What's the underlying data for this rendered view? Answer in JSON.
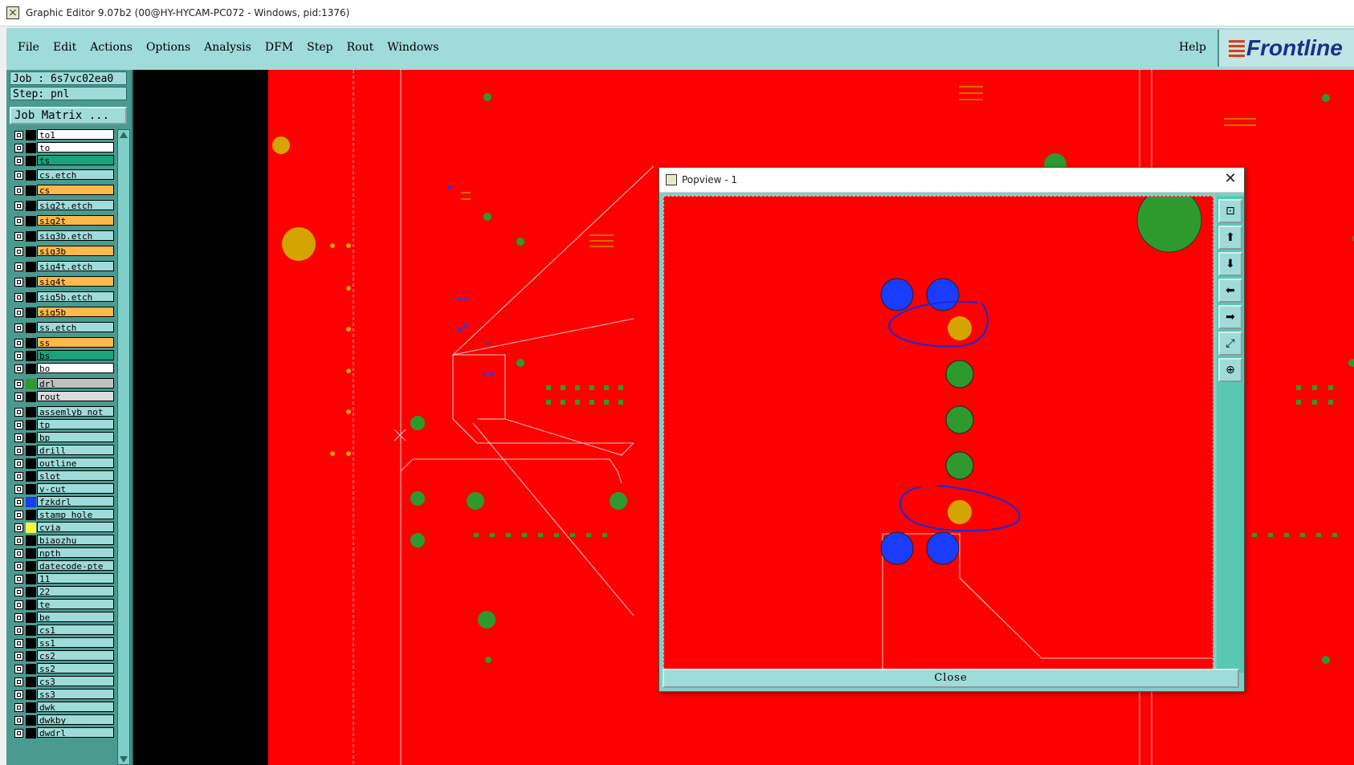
{
  "window": {
    "title": "Graphic Editor 9.07b2 (00@HY-HYCAM-PC072 - Windows, pid:1376)"
  },
  "menubar": {
    "items": [
      "File",
      "Edit",
      "Actions",
      "Options",
      "Analysis",
      "DFM",
      "Step",
      "Rout",
      "Windows"
    ],
    "help": "Help",
    "logo": "Frontline"
  },
  "job": {
    "label": "Job : 6s7vc02ea0",
    "step": "Step: pnl",
    "matrix_button": "Job Matrix ..."
  },
  "layers": [
    {
      "name": "to1",
      "color": "#ffffff",
      "swatch": "#000000"
    },
    {
      "name": "to",
      "color": "#ffffff",
      "swatch": "#000000"
    },
    {
      "name": "ts",
      "color": "#1aa37a",
      "swatch": "#000000"
    },
    {
      "name": "cs.etch",
      "color": "#9fdbd9",
      "swatch": "#000000"
    },
    {
      "name": "cs",
      "color": "#ffb84a",
      "swatch": "#000000"
    },
    {
      "name": "sig2t.etch",
      "color": "#9fdbd9",
      "swatch": "#000000"
    },
    {
      "name": "sig2t",
      "color": "#ffb84a",
      "swatch": "#000000"
    },
    {
      "name": "sig3b.etch",
      "color": "#9fdbd9",
      "swatch": "#000000"
    },
    {
      "name": "sig3b",
      "color": "#ffb84a",
      "swatch": "#000000"
    },
    {
      "name": "sig4t.etch",
      "color": "#9fdbd9",
      "swatch": "#000000"
    },
    {
      "name": "sig4t",
      "color": "#ffb84a",
      "swatch": "#000000"
    },
    {
      "name": "sig5b.etch",
      "color": "#9fdbd9",
      "swatch": "#000000"
    },
    {
      "name": "sig5b",
      "color": "#ffb84a",
      "swatch": "#000000"
    },
    {
      "name": "ss.etch",
      "color": "#9fdbd9",
      "swatch": "#000000"
    },
    {
      "name": "ss",
      "color": "#ffb84a",
      "swatch": "#000000"
    },
    {
      "name": "bs",
      "color": "#1aa37a",
      "swatch": "#000000"
    },
    {
      "name": "bo",
      "color": "#ffffff",
      "swatch": "#000000"
    },
    {
      "name": "drl",
      "color": "#c0c0c0",
      "swatch": "#2e9a2e"
    },
    {
      "name": "rout",
      "color": "#dcdcdc",
      "swatch": "#000000"
    },
    {
      "name": "assemlyb_not",
      "color": "#9fdbd9",
      "swatch": "#000000"
    },
    {
      "name": "tp",
      "color": "#9fdbd9",
      "swatch": "#000000"
    },
    {
      "name": "bp",
      "color": "#9fdbd9",
      "swatch": "#000000"
    },
    {
      "name": "drill",
      "color": "#9fdbd9",
      "swatch": "#000000"
    },
    {
      "name": "outline",
      "color": "#9fdbd9",
      "swatch": "#000000"
    },
    {
      "name": "slot",
      "color": "#9fdbd9",
      "swatch": "#000000"
    },
    {
      "name": "v-cut",
      "color": "#9fdbd9",
      "swatch": "#000000"
    },
    {
      "name": "fzkdrl",
      "color": "#9fdbd9",
      "swatch": "#1a3cff"
    },
    {
      "name": "stamp_hole",
      "color": "#9fdbd9",
      "swatch": "#000000"
    },
    {
      "name": "cvia",
      "color": "#9fdbd9",
      "swatch": "#f5f542"
    },
    {
      "name": "biaozhu",
      "color": "#9fdbd9",
      "swatch": "#000000"
    },
    {
      "name": "npth",
      "color": "#9fdbd9",
      "swatch": "#000000"
    },
    {
      "name": "datecode-pte",
      "color": "#9fdbd9",
      "swatch": "#000000"
    },
    {
      "name": "11",
      "color": "#9fdbd9",
      "swatch": "#000000"
    },
    {
      "name": "22",
      "color": "#9fdbd9",
      "swatch": "#000000"
    },
    {
      "name": "te",
      "color": "#9fdbd9",
      "swatch": "#000000"
    },
    {
      "name": "be",
      "color": "#9fdbd9",
      "swatch": "#000000"
    },
    {
      "name": "cs1",
      "color": "#9fdbd9",
      "swatch": "#000000"
    },
    {
      "name": "ss1",
      "color": "#9fdbd9",
      "swatch": "#000000"
    },
    {
      "name": "cs2",
      "color": "#9fdbd9",
      "swatch": "#000000"
    },
    {
      "name": "ss2",
      "color": "#9fdbd9",
      "swatch": "#000000"
    },
    {
      "name": "cs3",
      "color": "#9fdbd9",
      "swatch": "#000000"
    },
    {
      "name": "ss3",
      "color": "#9fdbd9",
      "swatch": "#000000"
    },
    {
      "name": "dwk",
      "color": "#9fdbd9",
      "swatch": "#000000"
    },
    {
      "name": "dwkby",
      "color": "#9fdbd9",
      "swatch": "#000000"
    },
    {
      "name": "dwdrl",
      "color": "#9fdbd9",
      "swatch": "#000000"
    }
  ],
  "popview": {
    "title": "Popview - 1",
    "close_label": "Close",
    "tools": [
      "zoom-home-icon",
      "pan-up-icon",
      "pan-down-icon",
      "pan-left-icon",
      "pan-right-icon",
      "zoom-out-icon",
      "zoom-in-icon"
    ]
  },
  "colors": {
    "board": "#ff0000",
    "pad_green": "#2e9a2e",
    "pad_yellow": "#d4a400",
    "pad_blue": "#1a3cff",
    "panel": "#9fdbd9",
    "accent": "#4a9a8f"
  }
}
